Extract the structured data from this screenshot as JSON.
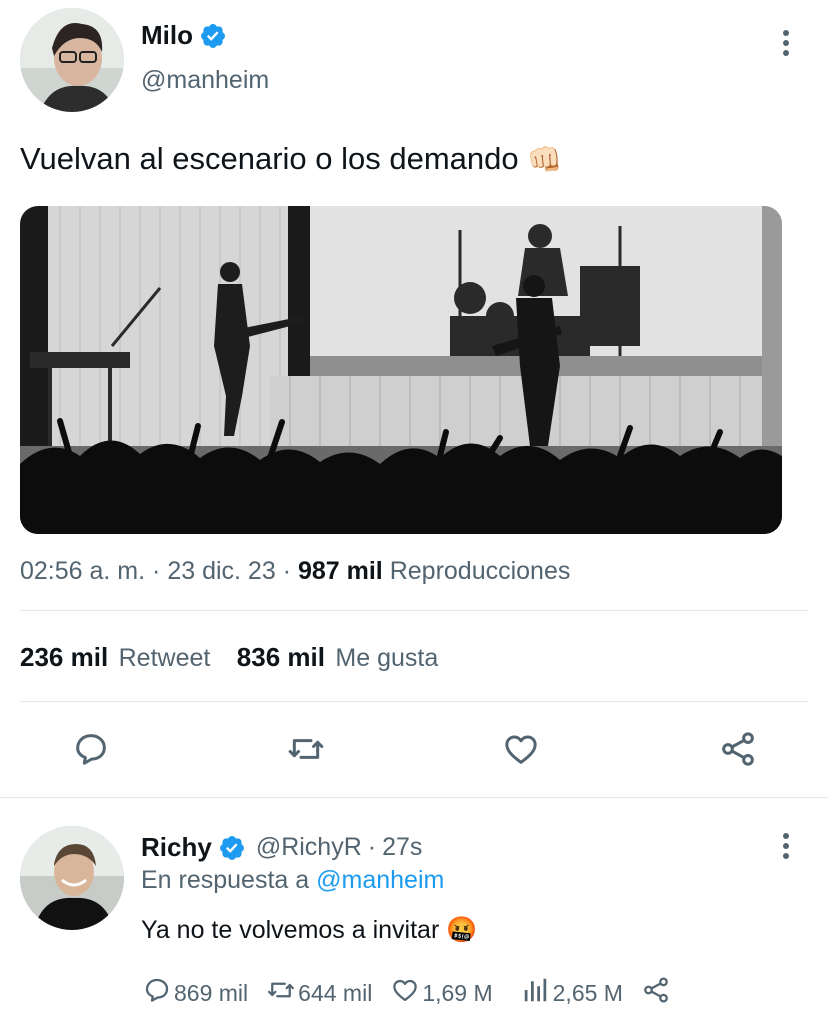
{
  "tweet": {
    "author_name": "Milo",
    "author_handle": "@manheim",
    "text": "Vuelvan al escenario o los demando",
    "emoji": "👊🏻",
    "time": "02:56 a. m.",
    "sep1": "·",
    "date": "23 dic. 23",
    "sep2": "·",
    "views_count": "987 mil",
    "views_label": "Reproducciones",
    "retweets_count": "236 mil",
    "retweets_label": "Retweet",
    "likes_count": "836 mil",
    "likes_label": "Me gusta"
  },
  "icons": {
    "verified": "verified-badge-icon",
    "more": "more-vertical-icon",
    "reply": "reply-icon",
    "retweet": "retweet-icon",
    "like": "heart-icon",
    "share": "share-icon",
    "views": "views-bar-icon"
  },
  "reply": {
    "author_name": "Richy",
    "author_handle": "@RichyR",
    "sep": "·",
    "time": "27s",
    "replying_prefix": "En respuesta a",
    "replying_to": "@manheim",
    "text": "Ya no te volvemos a invitar",
    "emoji": "🤬",
    "reply_count": "869 mil",
    "retweet_count": "644 mil",
    "like_count": "1,69 M",
    "view_count": "2,65 M"
  },
  "colors": {
    "accent": "#1d9bf0",
    "text": "#0f1419",
    "secondary": "#536471"
  }
}
